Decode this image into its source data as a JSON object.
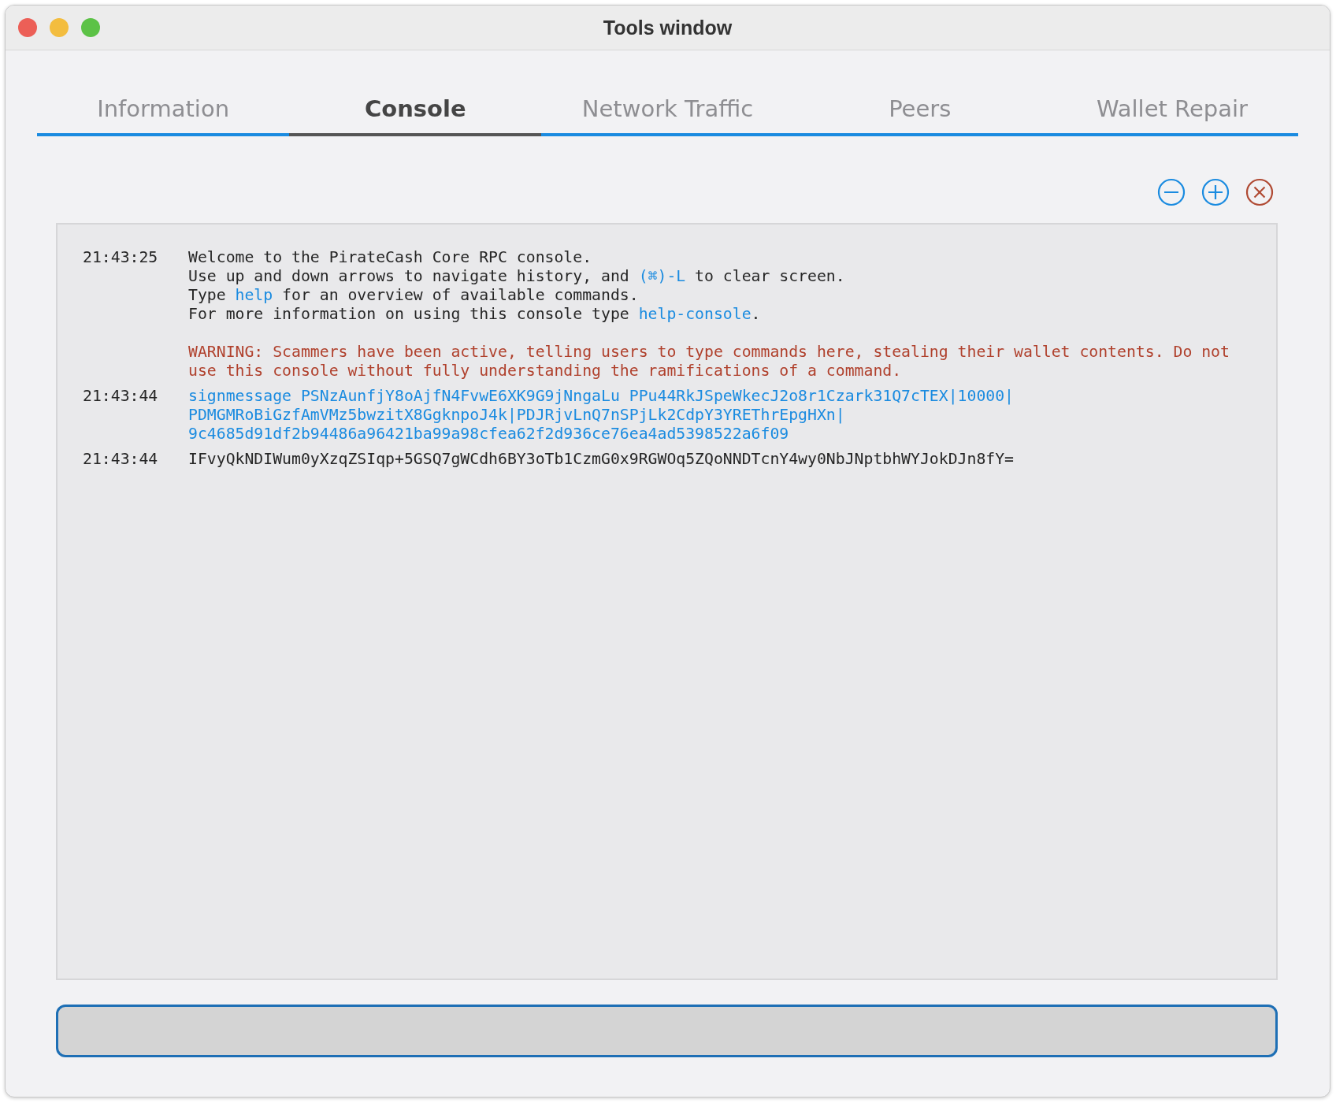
{
  "window": {
    "title": "Tools window"
  },
  "tabs": [
    {
      "label": "Information",
      "selected": false
    },
    {
      "label": "Console",
      "selected": true
    },
    {
      "label": "Network Traffic",
      "selected": false
    },
    {
      "label": "Peers",
      "selected": false
    },
    {
      "label": "Wallet Repair",
      "selected": false
    }
  ],
  "console": {
    "entries": [
      {
        "time": "21:43:25",
        "lines": [
          {
            "kind": "info",
            "segments": [
              {
                "text": "Welcome to the PirateCash Core RPC console."
              }
            ]
          },
          {
            "kind": "info",
            "segments": [
              {
                "text": "Use up and down arrows to navigate history, and "
              },
              {
                "text": "(⌘)-L",
                "link": true
              },
              {
                "text": " to clear screen."
              }
            ]
          },
          {
            "kind": "info",
            "segments": [
              {
                "text": "Type "
              },
              {
                "text": "help",
                "link": true
              },
              {
                "text": " for an overview of available commands."
              }
            ]
          },
          {
            "kind": "info",
            "segments": [
              {
                "text": "For more information on using this console type "
              },
              {
                "text": "help-console",
                "link": true
              },
              {
                "text": "."
              }
            ]
          },
          {
            "kind": "warning",
            "segments": [
              {
                "text": "WARNING: Scammers have been active, telling users to type commands here, stealing their wallet contents. Do not"
              }
            ]
          },
          {
            "kind": "warning",
            "segments": [
              {
                "text": "use this console without fully understanding the ramifications of a command."
              }
            ]
          }
        ]
      },
      {
        "time": "21:43:44",
        "lines": [
          {
            "kind": "command",
            "segments": [
              {
                "text": "signmessage PSNzAunfjY8oAjfN4FvwE6XK9G9jNngaLu PPu44RkJSpeWkecJ2o8r1Czark31Q7cTEX|10000|"
              }
            ]
          },
          {
            "kind": "command",
            "segments": [
              {
                "text": "PDMGMRoBiGzfAmVMz5bwzitX8GgknpoJ4k|PDJRjvLnQ7nSPjLk2CdpY3YREThrEpgHXn|"
              }
            ]
          },
          {
            "kind": "command",
            "segments": [
              {
                "text": "9c4685d91df2b94486a96421ba99a98cfea62f2d936ce76ea4ad5398522a6f09"
              }
            ]
          }
        ]
      },
      {
        "time": "21:43:44",
        "lines": [
          {
            "kind": "info",
            "segments": [
              {
                "text": "IFvyQkNDIWum0yXzqZSIqp+5GSQ7gWCdh6BY3oTb1CzmG0x9RGWOq5ZQoNNDTcnY4wy0NbJNptbhWYJokDJn8fY="
              }
            ]
          }
        ]
      }
    ]
  },
  "toolbar": [
    {
      "kind": "zoom-out"
    },
    {
      "kind": "zoom-in"
    },
    {
      "kind": "clear"
    }
  ]
}
